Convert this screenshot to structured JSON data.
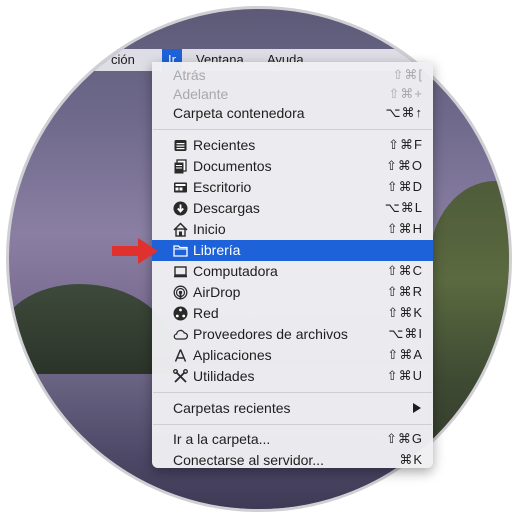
{
  "menubar": {
    "items": [
      {
        "label": "ción"
      },
      {
        "label": "Ir"
      },
      {
        "label": "Ventana"
      },
      {
        "label": "Ayuda"
      }
    ]
  },
  "menu": {
    "nav": [
      {
        "label": "Atrás",
        "shortcut": "⇧⌘[",
        "enabled": false
      },
      {
        "label": "Adelante",
        "shortcut": "⇧⌘+",
        "enabled": false
      },
      {
        "label": "Carpeta contenedora",
        "shortcut": "⌥⌘↑",
        "enabled": true
      }
    ],
    "places": [
      {
        "label": "Recientes",
        "shortcut": "⇧⌘F",
        "icon": "recents-icon"
      },
      {
        "label": "Documentos",
        "shortcut": "⇧⌘O",
        "icon": "documents-icon"
      },
      {
        "label": "Escritorio",
        "shortcut": "⇧⌘D",
        "icon": "desktop-icon"
      },
      {
        "label": "Descargas",
        "shortcut": "⌥⌘L",
        "icon": "downloads-icon"
      },
      {
        "label": "Inicio",
        "shortcut": "⇧⌘H",
        "icon": "home-icon"
      },
      {
        "label": "Librería",
        "shortcut": "",
        "icon": "folder-icon",
        "highlighted": true
      },
      {
        "label": "Computadora",
        "shortcut": "⇧⌘C",
        "icon": "computer-icon"
      },
      {
        "label": "AirDrop",
        "shortcut": "⇧⌘R",
        "icon": "airdrop-icon"
      },
      {
        "label": "Red",
        "shortcut": "⇧⌘K",
        "icon": "network-icon"
      },
      {
        "label": "Proveedores de archivos",
        "shortcut": "⌥⌘I",
        "icon": "cloud-icon"
      },
      {
        "label": "Aplicaciones",
        "shortcut": "⇧⌘A",
        "icon": "applications-icon"
      },
      {
        "label": "Utilidades",
        "shortcut": "⇧⌘U",
        "icon": "utilities-icon"
      }
    ],
    "recent_folders": {
      "label": "Carpetas recientes"
    },
    "goto": [
      {
        "label": "Ir a la carpeta...",
        "shortcut": "⇧⌘G"
      },
      {
        "label": "Conectarse al servidor...",
        "shortcut": "⌘K"
      }
    ]
  },
  "colors": {
    "highlight": "#1d62d9",
    "pointer_arrow": "#e0312f"
  }
}
